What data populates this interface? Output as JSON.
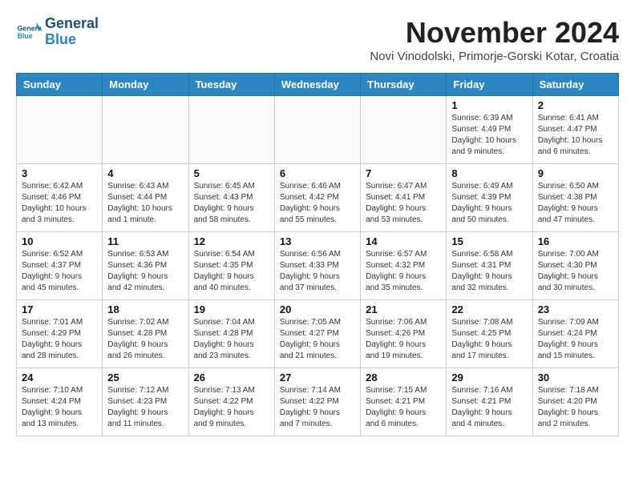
{
  "logo": {
    "line1": "General",
    "line2": "Blue"
  },
  "title": "November 2024",
  "location": "Novi Vinodolski, Primorje-Gorski Kotar, Croatia",
  "headers": [
    "Sunday",
    "Monday",
    "Tuesday",
    "Wednesday",
    "Thursday",
    "Friday",
    "Saturday"
  ],
  "weeks": [
    [
      {
        "day": "",
        "info": ""
      },
      {
        "day": "",
        "info": ""
      },
      {
        "day": "",
        "info": ""
      },
      {
        "day": "",
        "info": ""
      },
      {
        "day": "",
        "info": ""
      },
      {
        "day": "1",
        "info": "Sunrise: 6:39 AM\nSunset: 4:49 PM\nDaylight: 10 hours\nand 9 minutes."
      },
      {
        "day": "2",
        "info": "Sunrise: 6:41 AM\nSunset: 4:47 PM\nDaylight: 10 hours\nand 6 minutes."
      }
    ],
    [
      {
        "day": "3",
        "info": "Sunrise: 6:42 AM\nSunset: 4:46 PM\nDaylight: 10 hours\nand 3 minutes."
      },
      {
        "day": "4",
        "info": "Sunrise: 6:43 AM\nSunset: 4:44 PM\nDaylight: 10 hours\nand 1 minute."
      },
      {
        "day": "5",
        "info": "Sunrise: 6:45 AM\nSunset: 4:43 PM\nDaylight: 9 hours\nand 58 minutes."
      },
      {
        "day": "6",
        "info": "Sunrise: 6:46 AM\nSunset: 4:42 PM\nDaylight: 9 hours\nand 55 minutes."
      },
      {
        "day": "7",
        "info": "Sunrise: 6:47 AM\nSunset: 4:41 PM\nDaylight: 9 hours\nand 53 minutes."
      },
      {
        "day": "8",
        "info": "Sunrise: 6:49 AM\nSunset: 4:39 PM\nDaylight: 9 hours\nand 50 minutes."
      },
      {
        "day": "9",
        "info": "Sunrise: 6:50 AM\nSunset: 4:38 PM\nDaylight: 9 hours\nand 47 minutes."
      }
    ],
    [
      {
        "day": "10",
        "info": "Sunrise: 6:52 AM\nSunset: 4:37 PM\nDaylight: 9 hours\nand 45 minutes."
      },
      {
        "day": "11",
        "info": "Sunrise: 6:53 AM\nSunset: 4:36 PM\nDaylight: 9 hours\nand 42 minutes."
      },
      {
        "day": "12",
        "info": "Sunrise: 6:54 AM\nSunset: 4:35 PM\nDaylight: 9 hours\nand 40 minutes."
      },
      {
        "day": "13",
        "info": "Sunrise: 6:56 AM\nSunset: 4:33 PM\nDaylight: 9 hours\nand 37 minutes."
      },
      {
        "day": "14",
        "info": "Sunrise: 6:57 AM\nSunset: 4:32 PM\nDaylight: 9 hours\nand 35 minutes."
      },
      {
        "day": "15",
        "info": "Sunrise: 6:58 AM\nSunset: 4:31 PM\nDaylight: 9 hours\nand 32 minutes."
      },
      {
        "day": "16",
        "info": "Sunrise: 7:00 AM\nSunset: 4:30 PM\nDaylight: 9 hours\nand 30 minutes."
      }
    ],
    [
      {
        "day": "17",
        "info": "Sunrise: 7:01 AM\nSunset: 4:29 PM\nDaylight: 9 hours\nand 28 minutes."
      },
      {
        "day": "18",
        "info": "Sunrise: 7:02 AM\nSunset: 4:28 PM\nDaylight: 9 hours\nand 26 minutes."
      },
      {
        "day": "19",
        "info": "Sunrise: 7:04 AM\nSunset: 4:28 PM\nDaylight: 9 hours\nand 23 minutes."
      },
      {
        "day": "20",
        "info": "Sunrise: 7:05 AM\nSunset: 4:27 PM\nDaylight: 9 hours\nand 21 minutes."
      },
      {
        "day": "21",
        "info": "Sunrise: 7:06 AM\nSunset: 4:26 PM\nDaylight: 9 hours\nand 19 minutes."
      },
      {
        "day": "22",
        "info": "Sunrise: 7:08 AM\nSunset: 4:25 PM\nDaylight: 9 hours\nand 17 minutes."
      },
      {
        "day": "23",
        "info": "Sunrise: 7:09 AM\nSunset: 4:24 PM\nDaylight: 9 hours\nand 15 minutes."
      }
    ],
    [
      {
        "day": "24",
        "info": "Sunrise: 7:10 AM\nSunset: 4:24 PM\nDaylight: 9 hours\nand 13 minutes."
      },
      {
        "day": "25",
        "info": "Sunrise: 7:12 AM\nSunset: 4:23 PM\nDaylight: 9 hours\nand 11 minutes."
      },
      {
        "day": "26",
        "info": "Sunrise: 7:13 AM\nSunset: 4:22 PM\nDaylight: 9 hours\nand 9 minutes."
      },
      {
        "day": "27",
        "info": "Sunrise: 7:14 AM\nSunset: 4:22 PM\nDaylight: 9 hours\nand 7 minutes."
      },
      {
        "day": "28",
        "info": "Sunrise: 7:15 AM\nSunset: 4:21 PM\nDaylight: 9 hours\nand 6 minutes."
      },
      {
        "day": "29",
        "info": "Sunrise: 7:16 AM\nSunset: 4:21 PM\nDaylight: 9 hours\nand 4 minutes."
      },
      {
        "day": "30",
        "info": "Sunrise: 7:18 AM\nSunset: 4:20 PM\nDaylight: 9 hours\nand 2 minutes."
      }
    ]
  ]
}
